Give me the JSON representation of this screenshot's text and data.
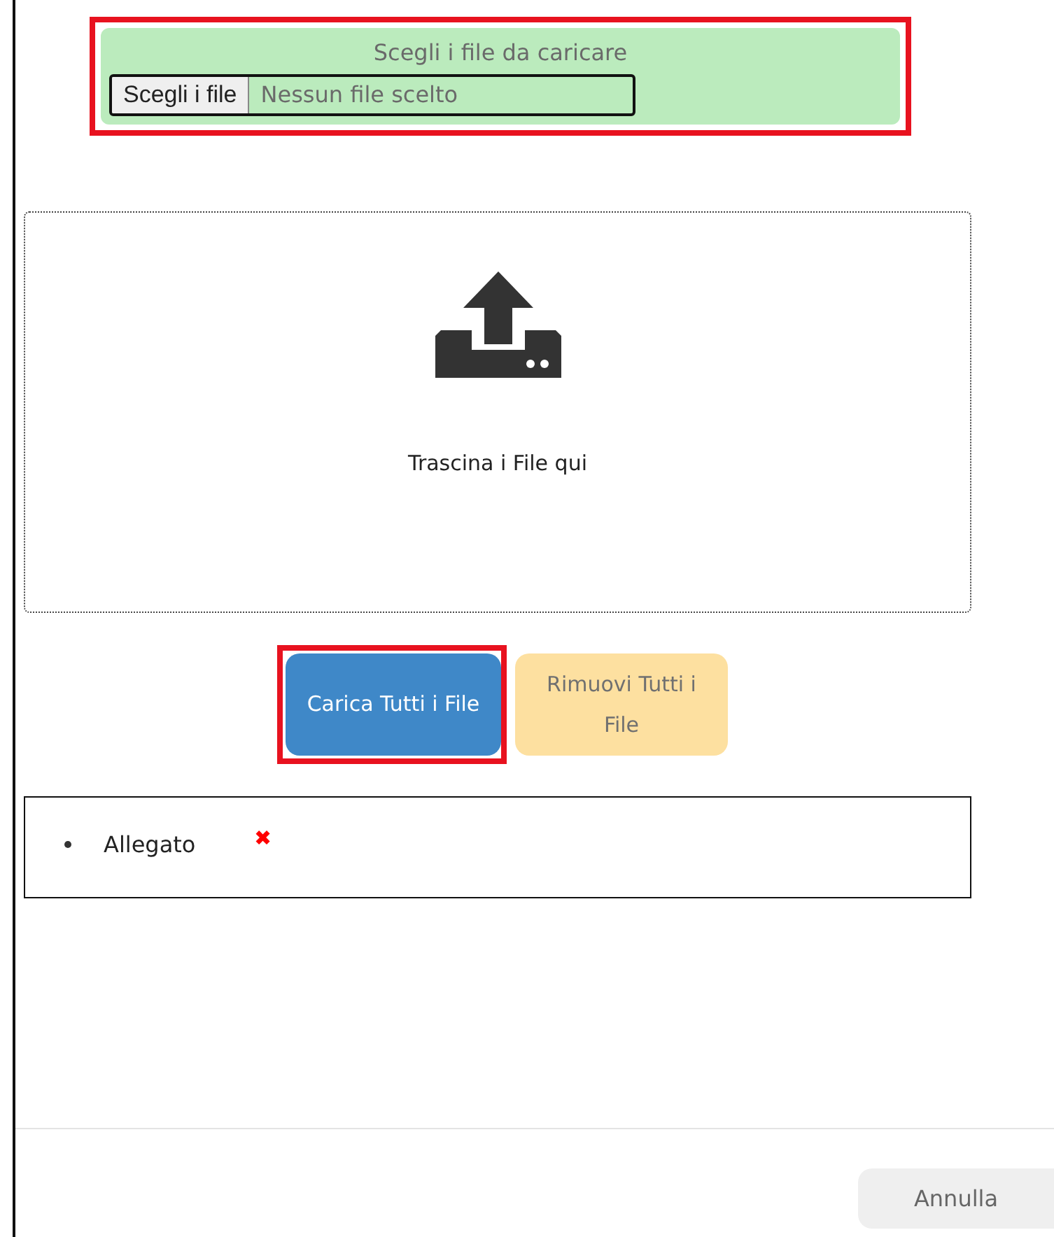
{
  "upload": {
    "title": "Scegli i file da caricare",
    "choose_button": "Scegli i file",
    "file_status": "Nessun file scelto",
    "highlighted": true
  },
  "dropzone": {
    "label": "Trascina i File qui"
  },
  "actions": [
    {
      "label": "Carica Tutti i File",
      "kind": "primary",
      "highlighted": true
    },
    {
      "label": "Rimuovi Tutti i File",
      "kind": "warning",
      "highlighted": false
    }
  ],
  "attachments": [
    {
      "name": "Allegato",
      "remove": "✖"
    }
  ],
  "footer": {
    "cancel": "Annulla"
  }
}
